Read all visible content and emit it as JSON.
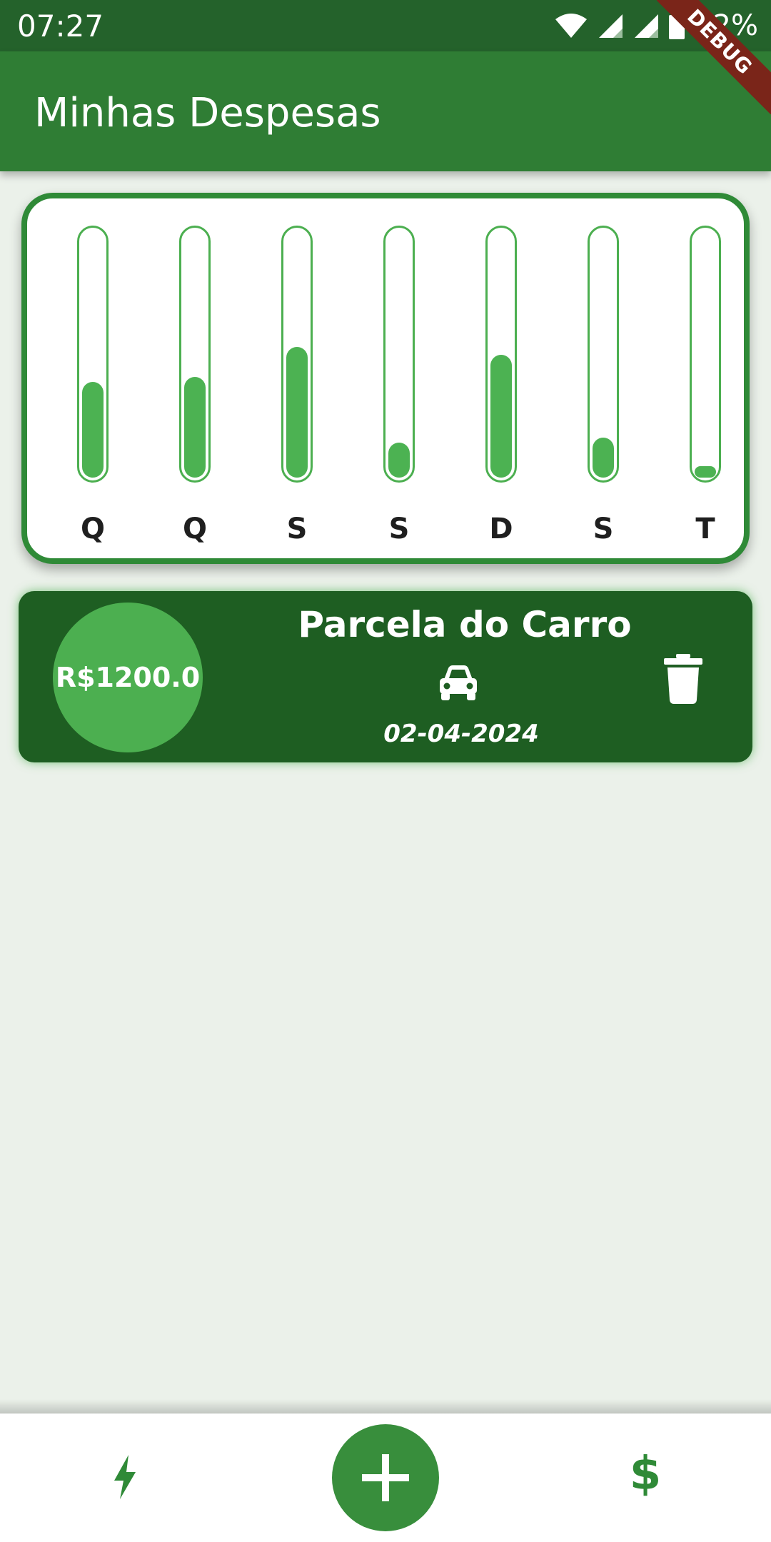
{
  "status_bar": {
    "time": "07:27",
    "battery": "72%",
    "icons": [
      "wifi-icon",
      "signal-icon",
      "signal-icon",
      "battery-icon"
    ]
  },
  "app_bar": {
    "title": "Minhas Despesas",
    "debug_banner": "DEBUG"
  },
  "chart_data": {
    "type": "bar",
    "categories": [
      "Q",
      "Q",
      "S",
      "S",
      "D",
      "S",
      "T"
    ],
    "values": [
      0.38,
      0.4,
      0.52,
      0.14,
      0.49,
      0.16,
      0.04
    ],
    "ylim": [
      0,
      1
    ],
    "colors": {
      "fill": "#4CB252",
      "track_border": "#4CAF50"
    }
  },
  "expense": {
    "amount": "R$1200.0",
    "title": "Parcela do Carro",
    "category_icon": "car-icon",
    "date": "02-04-2024",
    "delete_icon": "trash-icon"
  },
  "bottom_nav": {
    "left_icon": "lightning-icon",
    "center_icon": "plus-icon",
    "right_icon": "dollar-icon",
    "right_label": "$"
  },
  "colors": {
    "status_bar": "#24622B",
    "app_bar": "#2F7D34",
    "card_dark": "#1E5E22",
    "accent": "#4CAF50",
    "background": "#EBF1EA"
  }
}
